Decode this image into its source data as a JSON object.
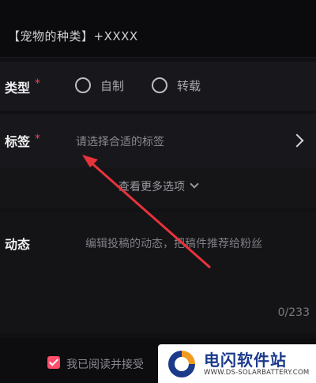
{
  "header": {
    "category_title": "【宠物的种类】+XXXX"
  },
  "type_field": {
    "label": "类型",
    "required_mark": "*",
    "options": [
      {
        "label": "自制",
        "selected": false
      },
      {
        "label": "转载",
        "selected": false
      }
    ]
  },
  "tag_field": {
    "label": "标签",
    "required_mark": "*",
    "placeholder": "请选择合适的标签",
    "chevron_icon": "chevron-right-icon"
  },
  "more_options": {
    "label": "查看更多选项",
    "icon": "chevron-down-icon"
  },
  "dynamic_field": {
    "label": "动态",
    "placeholder": "编辑投稿的动态，把稿件推荐给粉丝",
    "counter": "0/233"
  },
  "footer": {
    "agree_text": "我已阅读并接受",
    "checked": true
  },
  "watermark": {
    "title": "电闪软件站",
    "url": "WWW.DS-SOLARBATTERY.COM"
  },
  "annotation": {
    "arrow_color": "#e8333b"
  },
  "colors": {
    "accent": "#ff4d6a",
    "required": "#ff3b55",
    "background": "#111114",
    "watermark_blue": "#1b3a8a",
    "watermark_orange": "#f29a1f"
  }
}
